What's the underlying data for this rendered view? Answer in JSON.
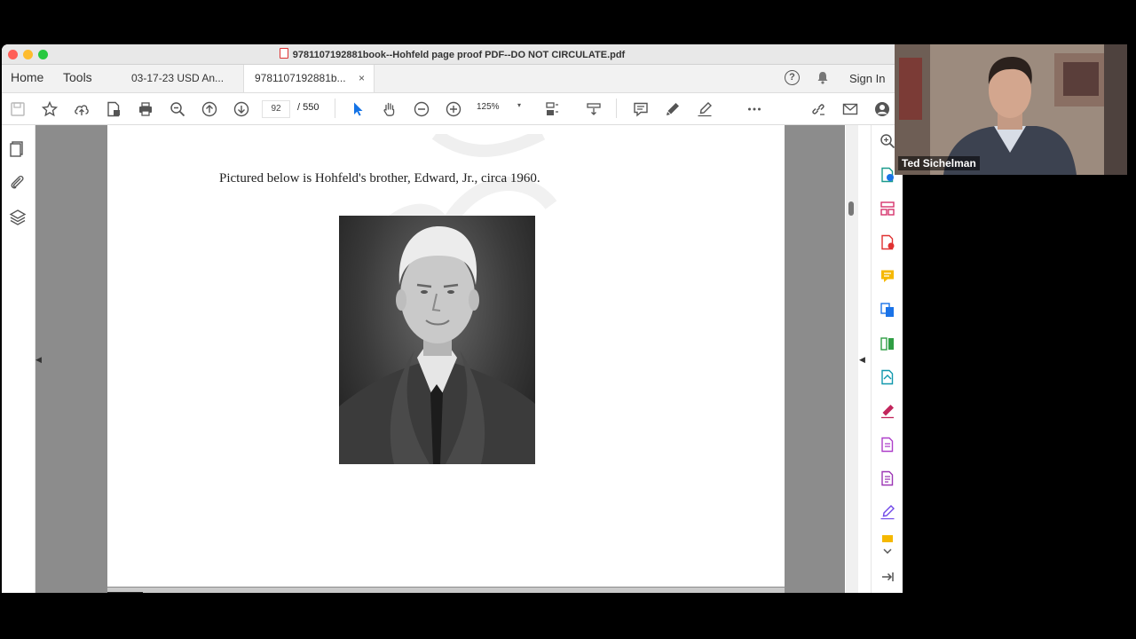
{
  "window": {
    "title": "9781107192881book--Hohfeld page proof PDF--DO NOT CIRCULATE.pdf"
  },
  "tabs": {
    "home": "Home",
    "tools": "Tools",
    "doc1": "03-17-23 USD An...",
    "doc2": "9781107192881b...",
    "close": "×"
  },
  "header": {
    "sign_in": "Sign In",
    "help": "?"
  },
  "toolbar": {
    "current_page": "92",
    "page_total": "/  550",
    "zoom": "125%",
    "zoom_caret": "▾"
  },
  "document": {
    "caption": "Pictured below is Hohfeld's brother, Edward, Jr., circa 1960."
  },
  "video": {
    "participant_name": "Ted Sichelman"
  },
  "colors": {
    "accent": "#1473e6",
    "close": "#ff5f57",
    "minimize": "#febc2e",
    "zoom": "#28c840"
  }
}
